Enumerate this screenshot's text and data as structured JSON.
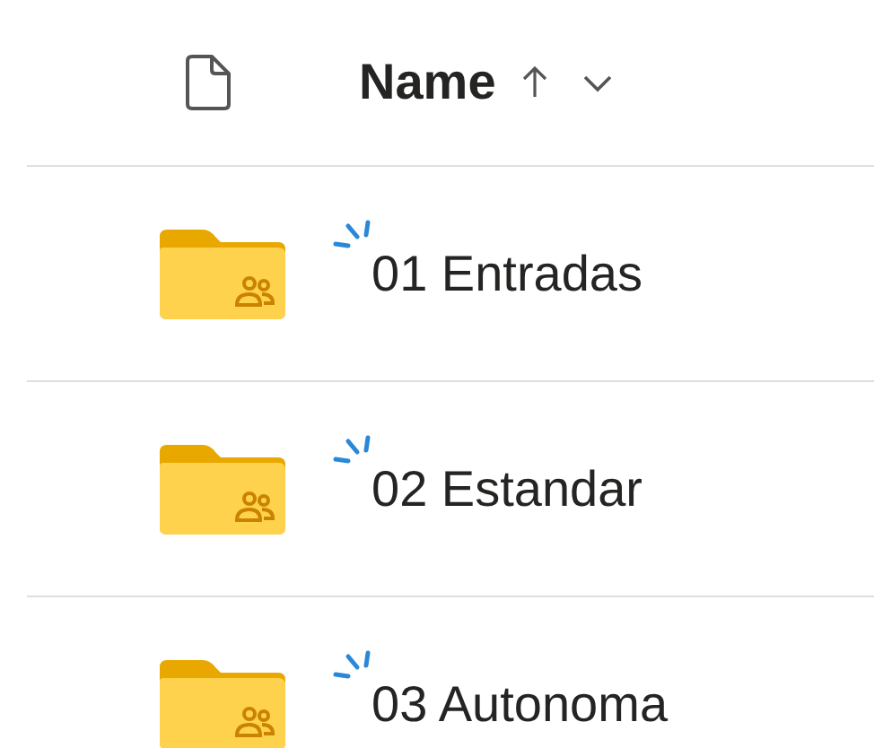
{
  "header": {
    "column": "Name",
    "sort_ascending": true
  },
  "rows": [
    {
      "name": "01 Entradas",
      "new": true,
      "shared": true
    },
    {
      "name": "02 Estandar",
      "new": true,
      "shared": true
    },
    {
      "name": "03 Autonoma",
      "new": true,
      "shared": true
    }
  ]
}
